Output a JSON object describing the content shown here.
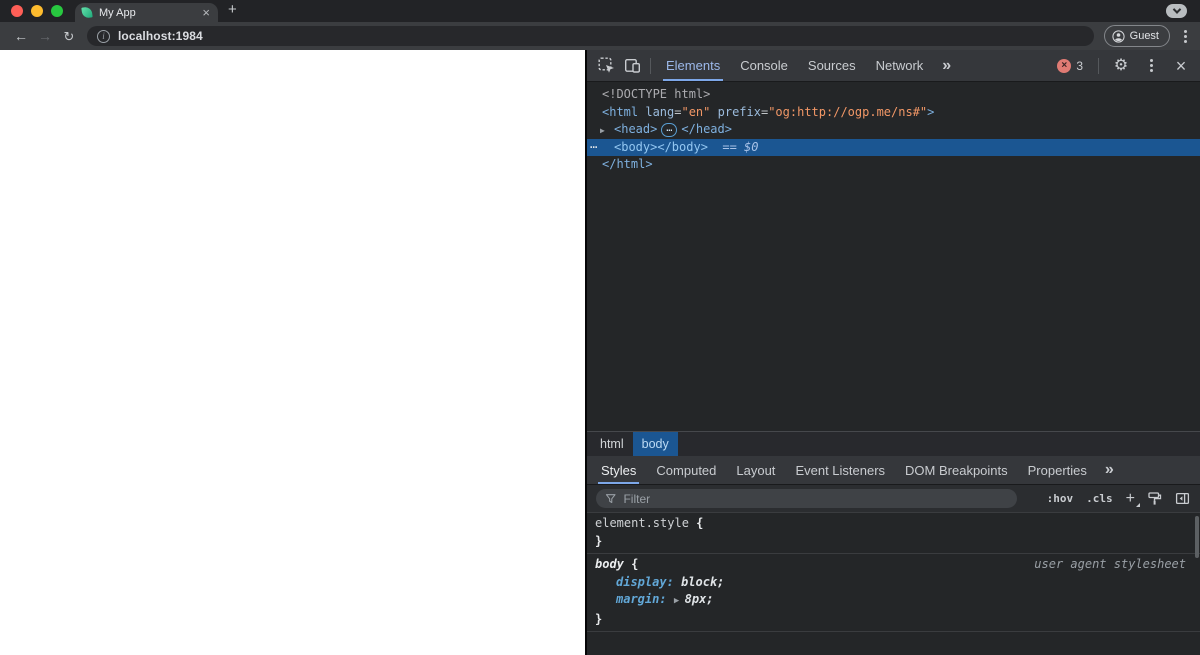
{
  "colors": {
    "accent_blue": "#8ab4f8",
    "selection_blue": "#1b5692",
    "error_red": "#e07b74",
    "tag_blue": "#7eb0df",
    "attr_value_orange": "#f29766",
    "traffic_red": "#ff5f57",
    "traffic_yellow": "#febc2e",
    "traffic_green": "#28c840",
    "page_background": "#ffffff",
    "devtools_background": "#242628"
  },
  "browser": {
    "tab": {
      "title": "My App",
      "close_glyph": "×"
    },
    "new_tab_glyph": "+",
    "back_glyph": "←",
    "forward_glyph": "→",
    "reload_glyph": "↻",
    "info_glyph": "i",
    "url": "localhost:1984",
    "profile": {
      "label": "Guest"
    }
  },
  "devtools": {
    "toolbar": {
      "tabs": [
        "Elements",
        "Console",
        "Sources",
        "Network"
      ],
      "active_tab": "Elements",
      "more_tabs_glyph": "»",
      "error_count": "3",
      "error_glyph": "×",
      "settings_glyph": "⚙",
      "close_glyph": "×"
    },
    "dom_rows": [
      {
        "indent": 0,
        "tokens": [
          {
            "t": "doctype",
            "s": "<!DOCTYPE html>"
          }
        ]
      },
      {
        "indent": 0,
        "tokens": [
          {
            "t": "tag",
            "s": "<html"
          },
          {
            "t": "attr",
            "s": " lang"
          },
          {
            "t": "punc",
            "s": "="
          },
          {
            "t": "val",
            "s": "\"en\""
          },
          {
            "t": "attr",
            "s": " prefix"
          },
          {
            "t": "punc",
            "s": "="
          },
          {
            "t": "val",
            "s": "\"og:http://ogp.me/ns#\""
          },
          {
            "t": "tag",
            "s": ">"
          }
        ]
      },
      {
        "indent": 1,
        "expander": "▶",
        "tokens": [
          {
            "t": "tag",
            "s": "<head>"
          },
          {
            "t": "badge",
            "s": "…"
          },
          {
            "t": "tag",
            "s": "</head>"
          }
        ]
      },
      {
        "indent": 1,
        "selected": true,
        "gutter": "⋯",
        "tokens": [
          {
            "t": "tag",
            "s": "<body>"
          },
          {
            "t": "tag",
            "s": "</body>"
          },
          {
            "t": "hint",
            "s": "  == $0"
          }
        ]
      },
      {
        "indent": 0,
        "tokens": [
          {
            "t": "tag",
            "s": "</html>"
          }
        ]
      }
    ],
    "breadcrumbs": [
      {
        "label": "html",
        "active": false
      },
      {
        "label": "body",
        "active": true
      }
    ],
    "styles": {
      "tabs": [
        "Styles",
        "Computed",
        "Layout",
        "Event Listeners",
        "DOM Breakpoints",
        "Properties"
      ],
      "active_tab": "Styles",
      "more_tabs_glyph": "»",
      "filter_placeholder": "Filter",
      "toggles": [
        {
          "label": ":hov",
          "name": "toggle-element-state"
        },
        {
          "label": ".cls",
          "name": "toggle-element-classes"
        },
        {
          "label": "+",
          "name": "new-style-rule",
          "has_menu": true
        }
      ],
      "rules": [
        {
          "selector": "element.style",
          "style": "plain",
          "open_brace": "{",
          "close_brace": "}",
          "origin": "",
          "properties": []
        },
        {
          "selector": "body",
          "style": "ua",
          "open_brace": "{",
          "close_brace": "}",
          "origin": "user agent stylesheet",
          "properties": [
            {
              "name": "display",
              "value": "block"
            },
            {
              "name": "margin",
              "value": "8px",
              "expandable": true,
              "arrow_glyph": "▶"
            }
          ]
        }
      ]
    }
  }
}
